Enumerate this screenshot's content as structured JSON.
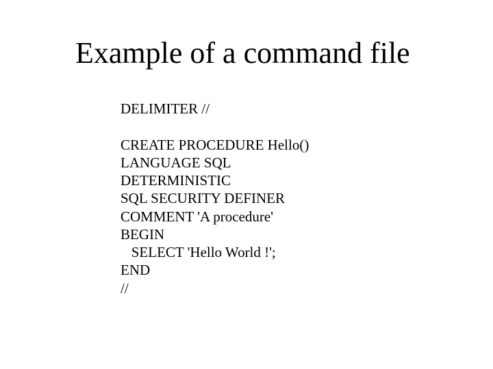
{
  "slide": {
    "title": "Example of a command file",
    "code_lines": {
      "l0": "DELIMITER //",
      "l1": "",
      "l2": "CREATE PROCEDURE Hello()",
      "l3": "LANGUAGE SQL",
      "l4": "DETERMINISTIC",
      "l5": "SQL SECURITY DEFINER",
      "l6": "COMMENT 'A procedure'",
      "l7": "BEGIN",
      "l8": "   SELECT 'Hello World !';",
      "l9": "END",
      "l10": "//"
    }
  }
}
